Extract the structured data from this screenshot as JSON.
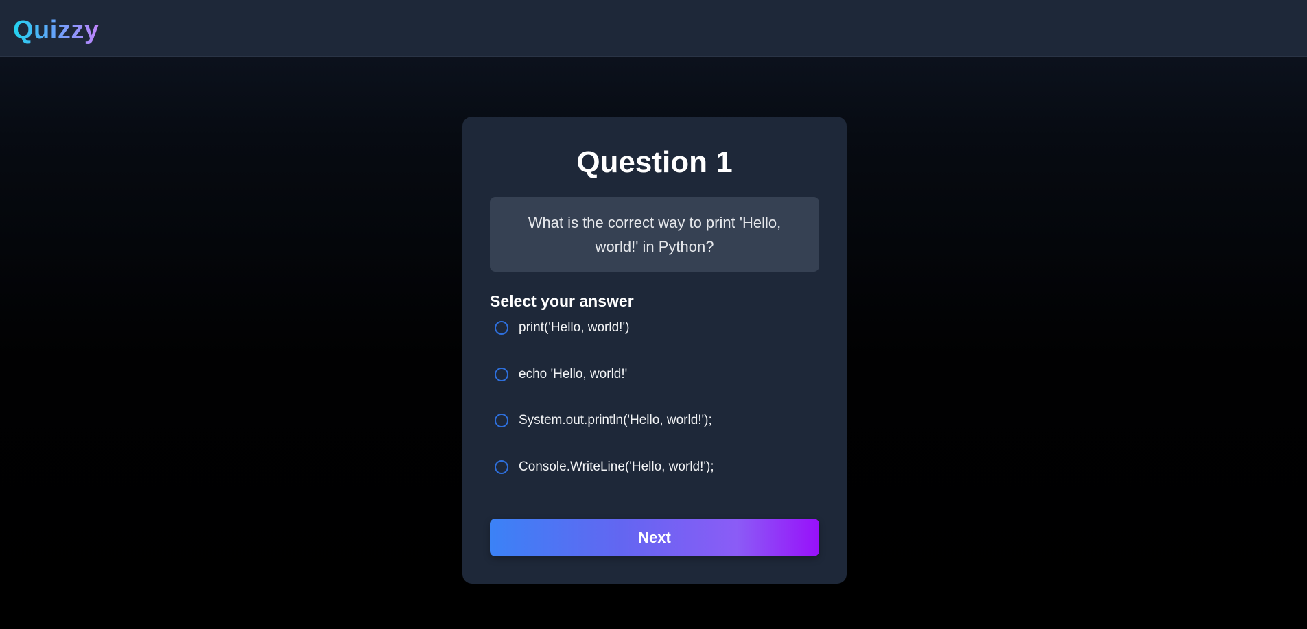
{
  "app": {
    "logo_text": "Quizzy",
    "colors": {
      "accent_start": "#22d3ee",
      "accent_end": "#c084fc",
      "card_bg": "#1e2839",
      "question_box_bg": "#364153",
      "radio_border": "#2e6fdc",
      "button_start": "#3b82f6",
      "button_end": "#9810fa"
    }
  },
  "quiz": {
    "title": "Question 1",
    "question": "What is the correct way to print 'Hello, world!' in Python?",
    "select_label": "Select your answer",
    "options": [
      {
        "label": "print('Hello, world!')",
        "selected": false
      },
      {
        "label": "echo 'Hello, world!'",
        "selected": false
      },
      {
        "label": "System.out.println('Hello, world!');",
        "selected": false
      },
      {
        "label": "Console.WriteLine('Hello, world!');",
        "selected": false
      }
    ],
    "next_label": "Next"
  }
}
